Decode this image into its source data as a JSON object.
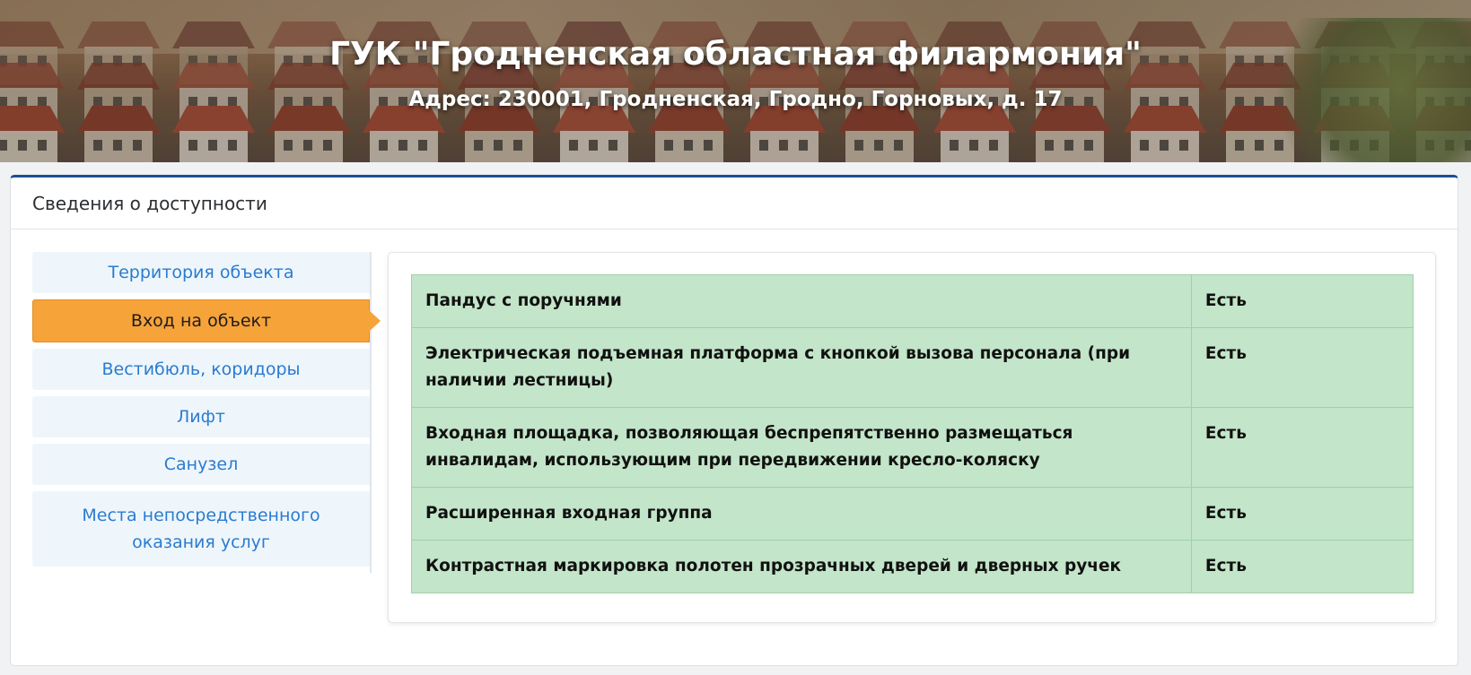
{
  "header": {
    "title": "ГУК \"Гродненская областная филармония\"",
    "address": "Адрес: 230001, Гродненская, Гродно, Горновых, д. 17"
  },
  "card": {
    "title": "Сведения о доступности"
  },
  "tabs": [
    {
      "label": "Территория объекта",
      "active": false
    },
    {
      "label": "Вход на объект",
      "active": true
    },
    {
      "label": "Вестибюль, коридоры",
      "active": false
    },
    {
      "label": "Лифт",
      "active": false
    },
    {
      "label": "Санузел",
      "active": false
    },
    {
      "label": "Места непосредственного оказания услуг",
      "active": false
    }
  ],
  "features": [
    {
      "name": "Пандус с поручнями",
      "value": "Есть"
    },
    {
      "name": "Электрическая подъемная платформа с кнопкой вызова персонала (при наличии лестницы)",
      "value": "Есть"
    },
    {
      "name": "Входная площадка, позволяющая беспрепятственно размещаться инвалидам, использующим при передвижении кресло-коляску",
      "value": "Есть"
    },
    {
      "name": "Расширенная входная группа",
      "value": "Есть"
    },
    {
      "name": "Контрастная маркировка полотен прозрачных дверей и дверных ручек",
      "value": "Есть"
    }
  ],
  "colors": {
    "accent": "#1d4f91",
    "active_tab": "#f6a33a",
    "tab_bg": "#eef6fc",
    "tab_text": "#2a7bd0",
    "table_bg": "#c3e5c9"
  },
  "icons": {
    "active_tab_pointer": "caret-right-icon"
  }
}
